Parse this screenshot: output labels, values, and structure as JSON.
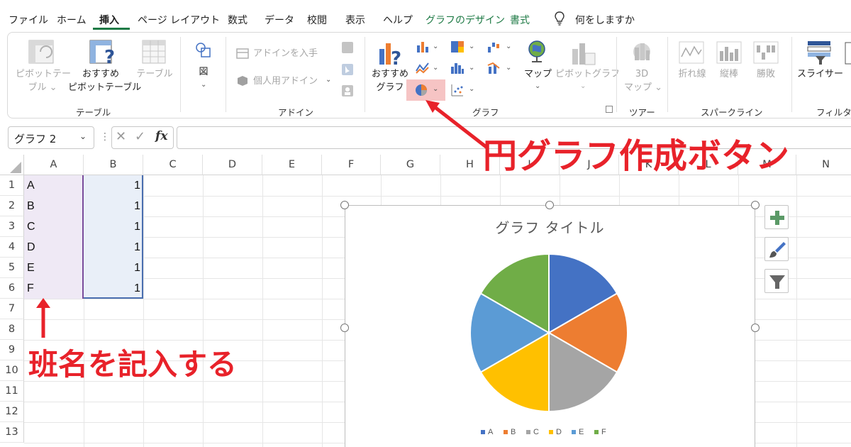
{
  "menu": {
    "tabs": [
      {
        "label": "ファイル"
      },
      {
        "label": "ホーム"
      },
      {
        "label": "挿入"
      },
      {
        "label": "ページ レイアウト"
      },
      {
        "label": "数式"
      },
      {
        "label": "データ"
      },
      {
        "label": "校閲"
      },
      {
        "label": "表示"
      },
      {
        "label": "ヘルプ"
      },
      {
        "label": "グラフのデザイン"
      },
      {
        "label": "書式"
      }
    ],
    "tell_me": "何をしますか"
  },
  "ribbon": {
    "table_group": {
      "label": "テーブル",
      "pivot_table": [
        "ピボットテー",
        "ブル"
      ],
      "recommended_pivot": [
        "おすすめ",
        "ピボットテーブル"
      ],
      "table": "テーブル"
    },
    "illustrations": {
      "label": "図"
    },
    "addins_group": {
      "label": "アドイン",
      "get_addins": "アドインを入手",
      "my_addins": "個人用アドイン"
    },
    "charts_group": {
      "label": "グラフ",
      "recommended_charts": [
        "おすすめ",
        "グラフ"
      ],
      "maps": "マップ",
      "pivot_chart": "ピボットグラフ"
    },
    "tours_group": {
      "label": "ツアー",
      "map3d": [
        "3D",
        "マップ"
      ]
    },
    "sparklines_group": {
      "label": "スパークライン",
      "line": "折れ線",
      "column": "縦棒",
      "win_loss": "勝敗"
    },
    "filter_group": {
      "label": "フィルター",
      "slicer": "スライサー"
    }
  },
  "formula_bar": {
    "name_box": "グラフ 2",
    "fx": "fx"
  },
  "sheet": {
    "columns": [
      "A",
      "B",
      "C",
      "D",
      "E",
      "F",
      "G",
      "H",
      "I",
      "J",
      "K",
      "L",
      "M",
      "N"
    ],
    "rows": [
      "1",
      "2",
      "3",
      "4",
      "5",
      "6",
      "7",
      "8",
      "9",
      "10",
      "11",
      "12",
      "13"
    ],
    "data": [
      {
        "a": "A",
        "b": "1"
      },
      {
        "a": "B",
        "b": "1"
      },
      {
        "a": "C",
        "b": "1"
      },
      {
        "a": "D",
        "b": "1"
      },
      {
        "a": "E",
        "b": "1"
      },
      {
        "a": "F",
        "b": "1"
      }
    ]
  },
  "chart": {
    "title": "グラフ タイトル",
    "legend": [
      "A",
      "B",
      "C",
      "D",
      "E",
      "F"
    ]
  },
  "chart_data": {
    "type": "pie",
    "title": "グラフ タイトル",
    "categories": [
      "A",
      "B",
      "C",
      "D",
      "E",
      "F"
    ],
    "values": [
      1,
      1,
      1,
      1,
      1,
      1
    ],
    "colors": [
      "#4472c4",
      "#ed7d31",
      "#a5a5a5",
      "#ffc000",
      "#5b9bd5",
      "#70ad47"
    ],
    "legend_position": "bottom"
  },
  "annotations": {
    "pie_button": "円グラフ作成ボタン",
    "enter_names": "班名を記入する",
    "color": "#e8222a"
  }
}
